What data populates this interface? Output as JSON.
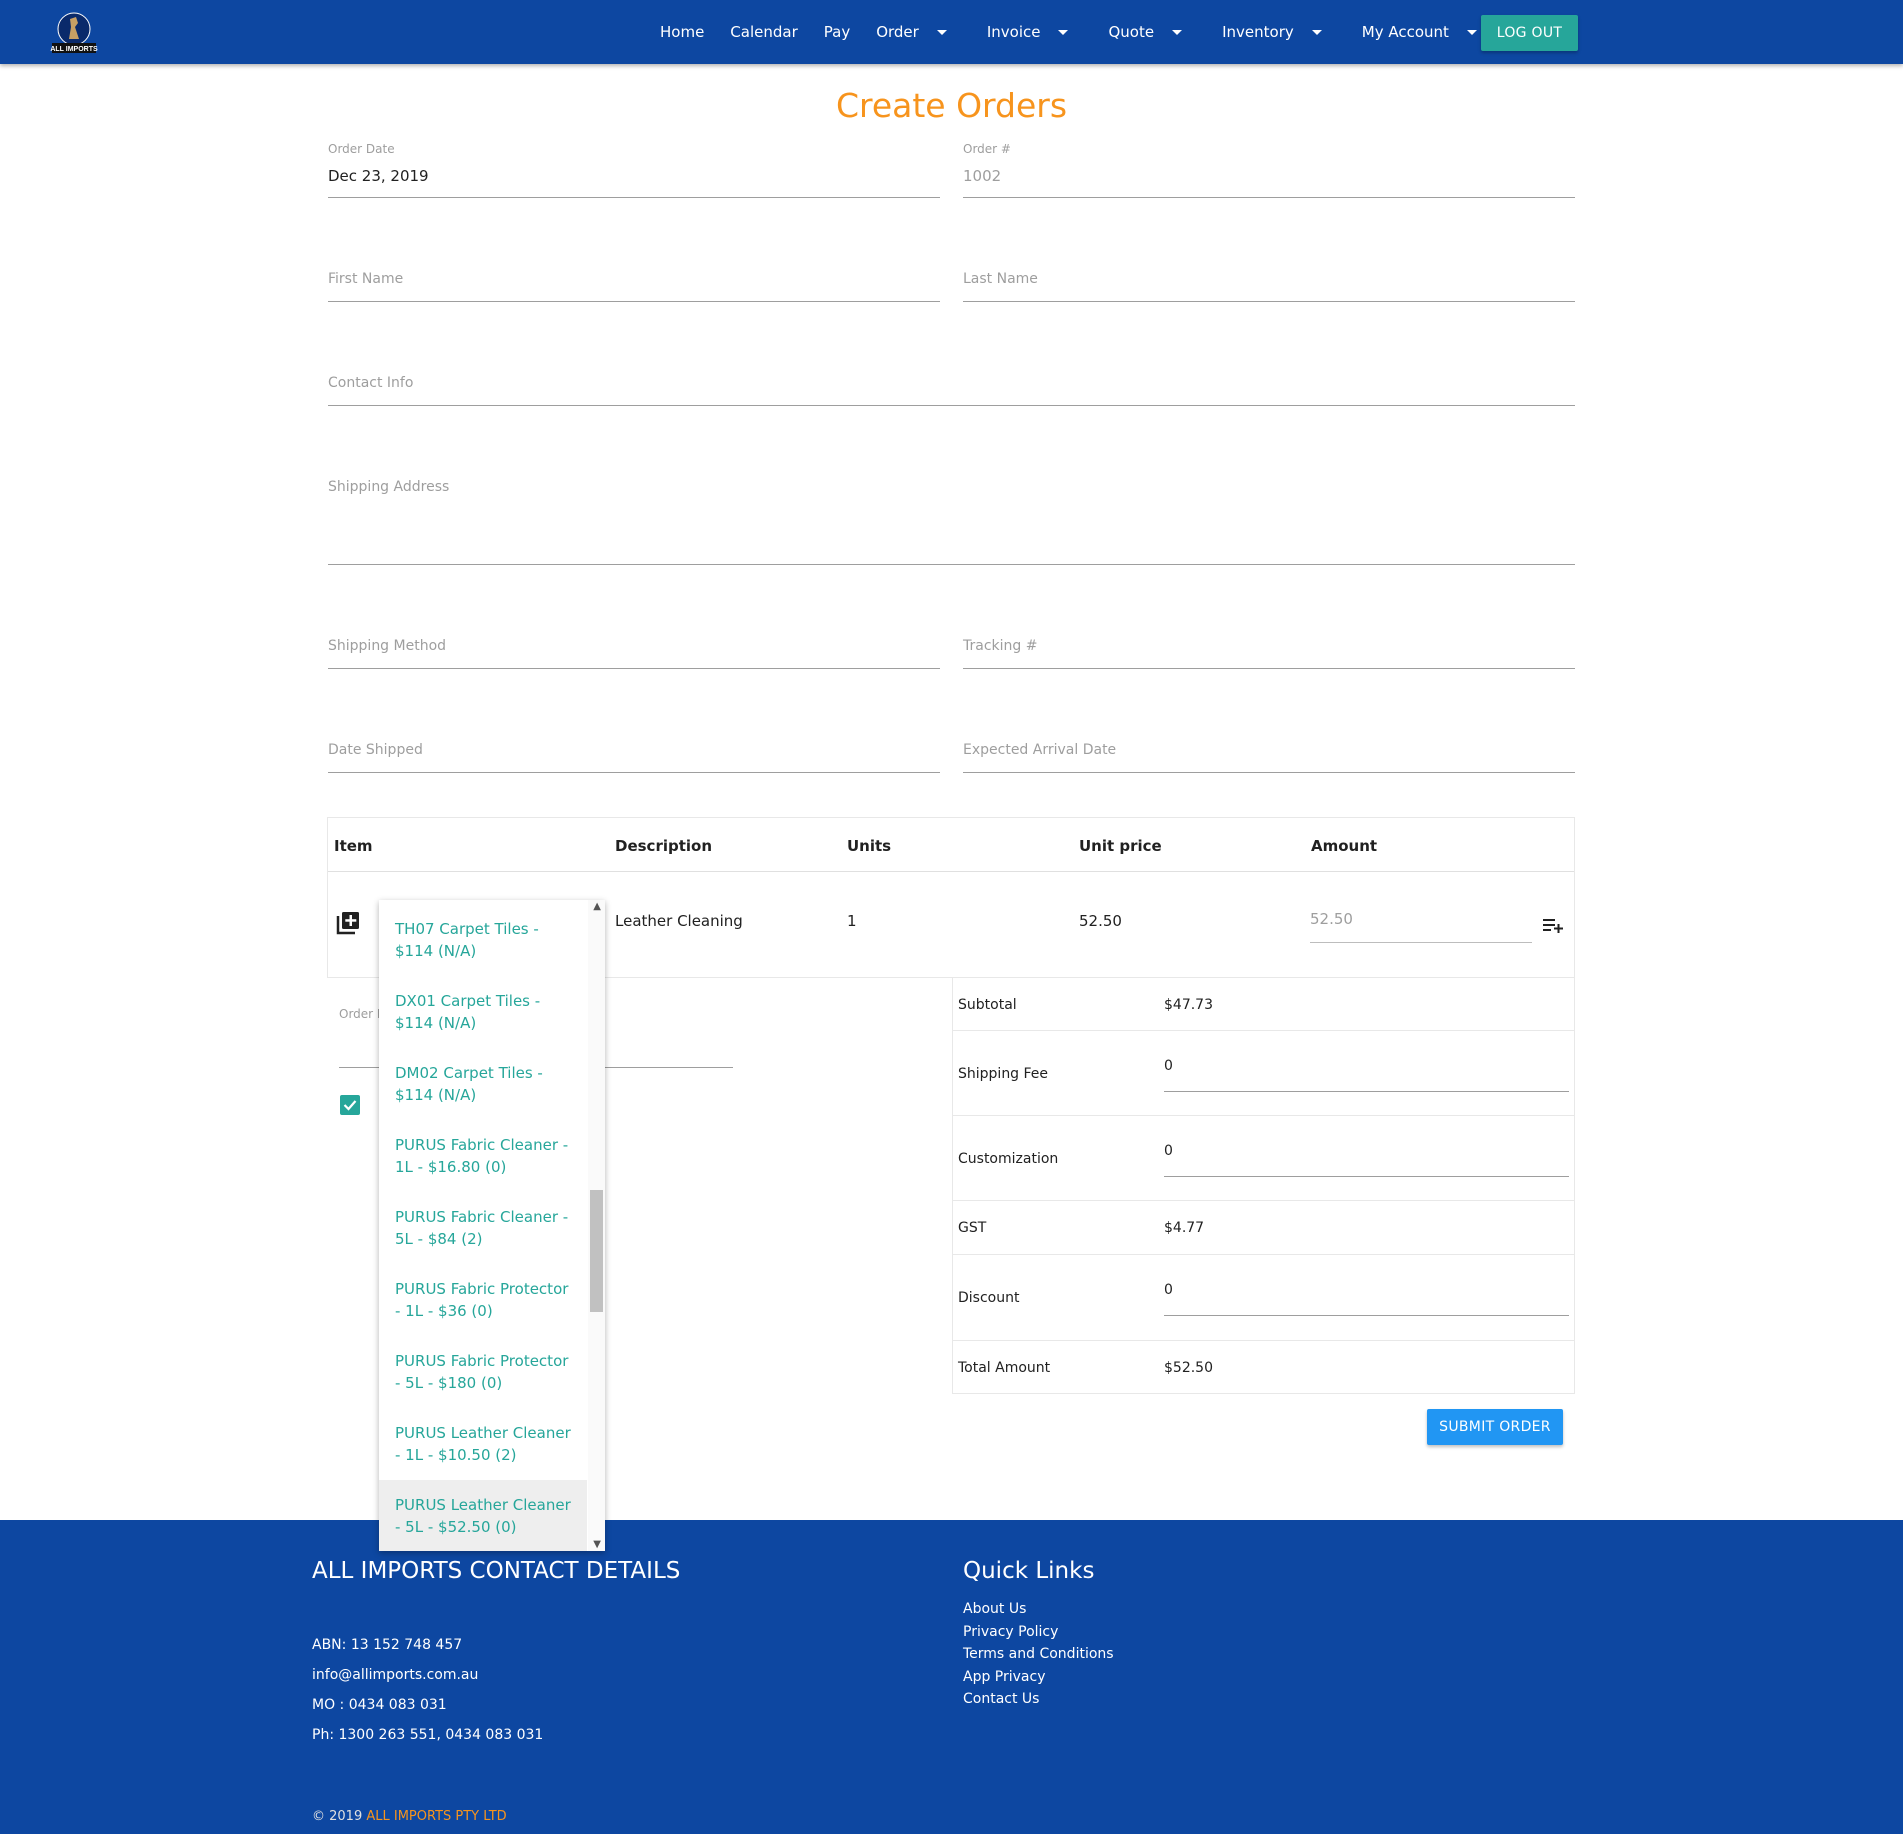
{
  "nav": {
    "items": [
      "Home",
      "Calendar",
      "Pay"
    ],
    "dropdowns": [
      "Order",
      "Invoice",
      "Quote",
      "Inventory",
      "My Account"
    ],
    "logout_label": "LOG OUT",
    "logo_text": "ALL IMPORTS"
  },
  "page_title": "Create Orders",
  "form": {
    "order_date_label": "Order Date",
    "order_date_value": "Dec 23, 2019",
    "order_number_label": "Order #",
    "order_number_value": "1002",
    "first_name_placeholder": "First Name",
    "last_name_placeholder": "Last Name",
    "contact_info_placeholder": "Contact Info",
    "shipping_address_placeholder": "Shipping Address",
    "shipping_method_placeholder": "Shipping Method",
    "tracking_placeholder": "Tracking #",
    "date_shipped_placeholder": "Date Shipped",
    "expected_arrival_placeholder": "Expected Arrival Date"
  },
  "table": {
    "headers": [
      "Item",
      "Description",
      "Units",
      "Unit price",
      "Amount"
    ],
    "row": {
      "description": "Leather Cleaning",
      "units": "1",
      "unit_price": "52.50",
      "amount": "52.50"
    }
  },
  "notes_label": "Order N",
  "dropdown_options": [
    "TH07 Carpet Tiles - $114 (N/A)",
    "DX01 Carpet Tiles - $114 (N/A)",
    "DM02 Carpet Tiles - $114 (N/A)",
    "PURUS Fabric Cleaner - 1L - $16.80 (0)",
    "PURUS Fabric Cleaner - 5L - $84 (2)",
    "PURUS Fabric Protector - 1L - $36 (0)",
    "PURUS Fabric Protector - 5L - $180 (0)",
    "PURUS Leather Cleaner - 1L - $10.50 (2)",
    "PURUS Leather Cleaner - 5L - $52.50 (0)"
  ],
  "totals": {
    "subtotal_label": "Subtotal",
    "subtotal": "$47.73",
    "shipping_label": "Shipping Fee",
    "shipping": "0",
    "custom_label": "Customization",
    "custom": "0",
    "gst_label": "GST",
    "gst": "$4.77",
    "discount_label": "Discount",
    "discount": "0",
    "total_label": "Total Amount",
    "total": "$52.50"
  },
  "submit_label": "SUBMIT ORDER",
  "footer": {
    "contact_heading": "ALL IMPORTS CONTACT DETAILS",
    "abn": "ABN: 13 152 748 457",
    "email": "info@allimports.com.au",
    "mobile": "MO : 0434 083 031",
    "phone": "Ph: 1300 263 551, 0434 083 031",
    "links_heading": "Quick Links",
    "links": [
      "About Us",
      "Privacy Policy",
      "Terms and Conditions",
      "App Privacy",
      "Contact Us"
    ],
    "copyright_prefix": "© 2019 ",
    "copyright_brand": "ALL IMPORTS PTY LTD"
  },
  "colors": {
    "nav": "#0d47a1",
    "title": "#f7941d",
    "teal": "#26a69a",
    "submit": "#2196f3"
  }
}
